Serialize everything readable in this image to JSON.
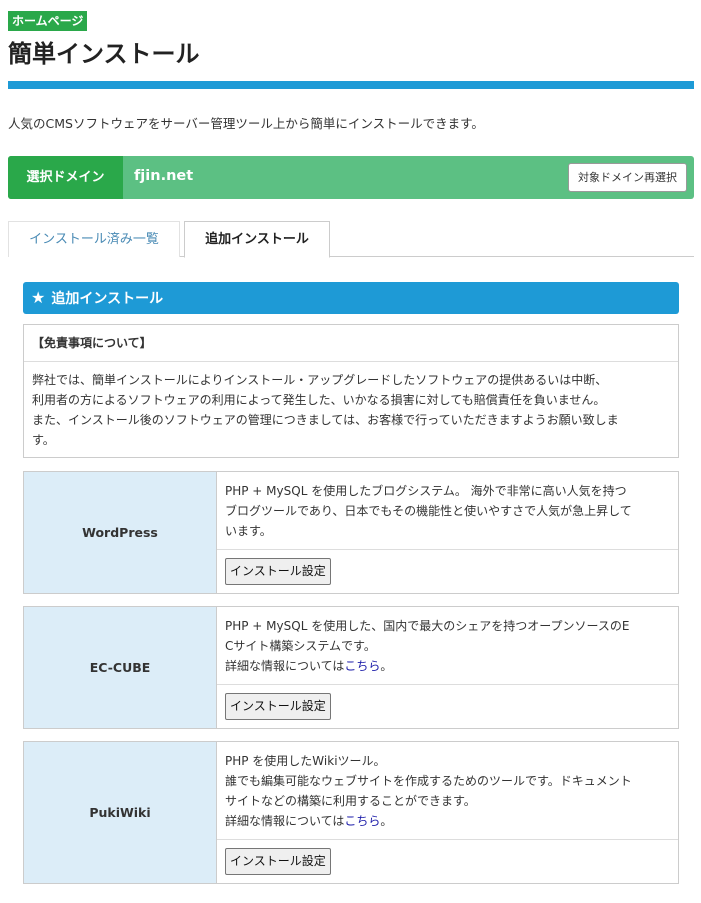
{
  "header": {
    "badge": "ホームページ",
    "title": "簡単インストール",
    "intro": "人気のCMSソフトウェアをサーバー管理ツール上から簡単にインストールできます。"
  },
  "domain": {
    "label": "選択ドメイン",
    "value": "fjin.net",
    "reselect_label": "対象ドメイン再選択"
  },
  "tabs": [
    {
      "label": "インストール済み一覧",
      "active": false
    },
    {
      "label": "追加インストール",
      "active": true
    }
  ],
  "section": {
    "title": "追加インストール"
  },
  "disclaimer": {
    "title": "【免責事項について】",
    "lines": [
      "弊社では、簡単インストールによりインストール・アップグレードしたソフトウェアの提供あるいは中断、",
      "利用者の方によるソフトウェアの利用によって発生した、いかなる損害に対しても賠償責任を負いません。",
      "また、インストール後のソフトウェアの管理につきましては、お客様で行っていただきますようお願い致しま",
      "す。"
    ]
  },
  "apps": [
    {
      "name": "WordPress",
      "desc_lines": [
        "PHP + MySQL を使用したブログシステム。 海外で非常に高い人気を持つ",
        "ブログツールであり、日本でもその機能性と使いやすさで人気が急上昇して",
        "います。"
      ],
      "install_label": "インストール設定"
    },
    {
      "name": "EC-CUBE",
      "desc_lines": [
        "PHP + MySQL を使用した、国内で最大のシェアを持つオープンソースのE",
        "Cサイト構築システムです。"
      ],
      "info_prefix": "詳細な情報については",
      "info_link": "こちら",
      "info_suffix": "。",
      "install_label": "インストール設定"
    },
    {
      "name": "PukiWiki",
      "desc_lines": [
        "PHP を使用したWikiツール。",
        "誰でも編集可能なウェブサイトを作成するためのツールです。ドキュメント",
        "サイトなどの構築に利用することができます。"
      ],
      "info_prefix": "詳細な情報については",
      "info_link": "こちら",
      "info_suffix": "。",
      "install_label": "インストール設定"
    }
  ],
  "colors": {
    "accent_blue": "#1e9ad6",
    "brand_green": "#2aa84a",
    "domain_bar_green": "#5cc083",
    "app_name_bg": "#dcedf8",
    "link": "#1a1aa8"
  }
}
